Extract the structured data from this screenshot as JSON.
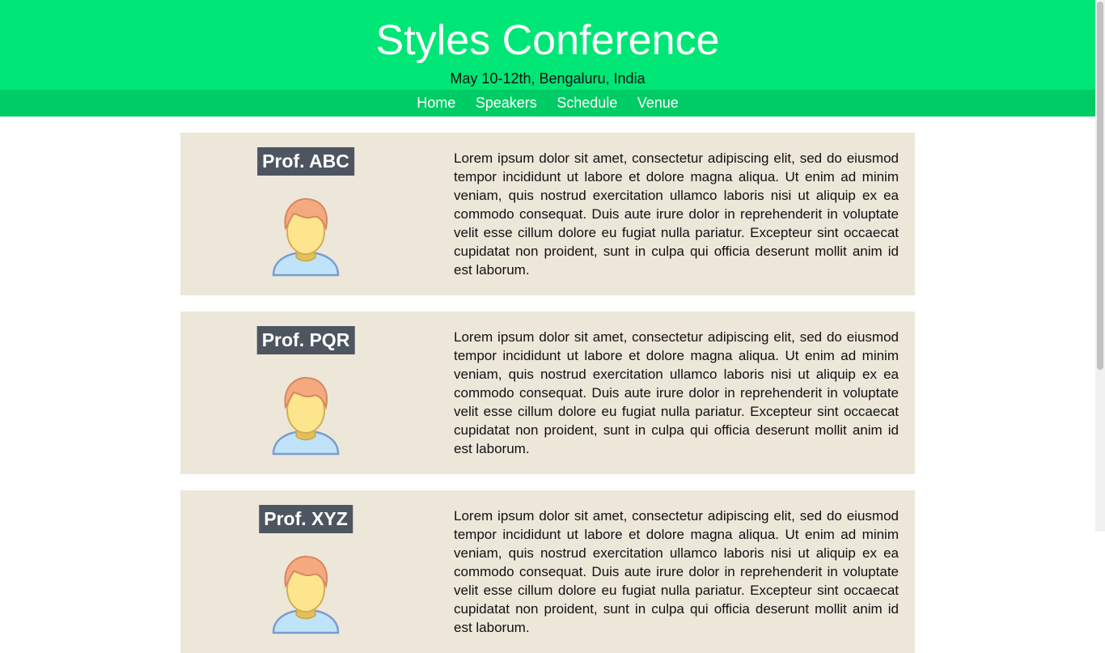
{
  "header": {
    "title": "Styles Conference",
    "subtitle": "May 10-12th, Bengaluru, India",
    "background_color": "#00e676",
    "nav_background_color": "#00cc66"
  },
  "nav": {
    "items": [
      "Home",
      "Speakers",
      "Schedule",
      "Venue"
    ]
  },
  "speakers": [
    {
      "name": "Prof. ABC",
      "icon": "user-avatar-icon",
      "bio": "Lorem ipsum dolor sit amet, consectetur adipiscing elit, sed do eiusmod tempor incididunt ut labore et dolore magna aliqua. Ut enim ad minim veniam, quis nostrud exercitation ullamco laboris nisi ut aliquip ex ea commodo consequat. Duis aute irure dolor in reprehenderit in voluptate velit esse cillum dolore eu fugiat nulla pariatur. Excepteur sint occaecat cupidatat non proident, sunt in culpa qui officia deserunt mollit anim id est laborum."
    },
    {
      "name": "Prof. PQR",
      "icon": "user-avatar-icon",
      "bio": "Lorem ipsum dolor sit amet, consectetur adipiscing elit, sed do eiusmod tempor incididunt ut labore et dolore magna aliqua. Ut enim ad minim veniam, quis nostrud exercitation ullamco laboris nisi ut aliquip ex ea commodo consequat. Duis aute irure dolor in reprehenderit in voluptate velit esse cillum dolore eu fugiat nulla pariatur. Excepteur sint occaecat cupidatat non proident, sunt in culpa qui officia deserunt mollit anim id est laborum."
    },
    {
      "name": "Prof. XYZ",
      "icon": "user-avatar-icon",
      "bio": "Lorem ipsum dolor sit amet, consectetur adipiscing elit, sed do eiusmod tempor incididunt ut labore et dolore magna aliqua. Ut enim ad minim veniam, quis nostrud exercitation ullamco laboris nisi ut aliquip ex ea commodo consequat. Duis aute irure dolor in reprehenderit in voluptate velit esse cillum dolore eu fugiat nulla pariatur. Excepteur sint occaecat cupidatat non proident, sunt in culpa qui officia deserunt mollit anim id est laborum."
    }
  ],
  "colors": {
    "card_background": "#ede7da",
    "name_tag_background": "#4c5560"
  }
}
